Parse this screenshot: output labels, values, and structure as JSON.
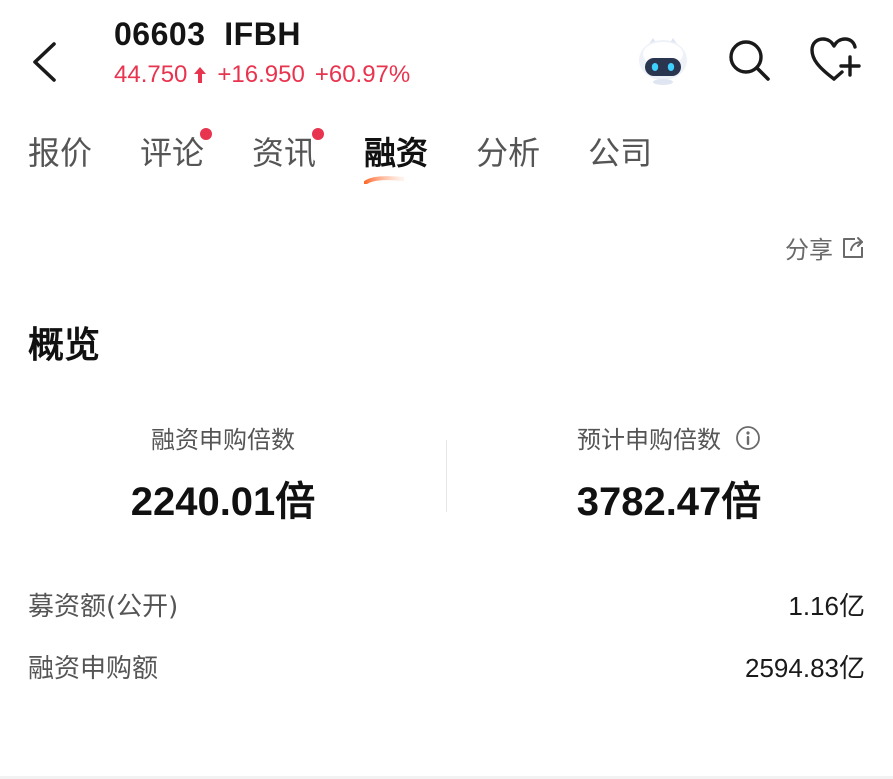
{
  "header": {
    "code": "06603",
    "name": "IFBH",
    "price": "44.750",
    "change": "+16.950",
    "change_pct": "+60.97%",
    "up_color": "#e8344e"
  },
  "header_icons": [
    "robot-assistant-icon",
    "search-icon",
    "heart-add-icon"
  ],
  "tabs": [
    {
      "label": "报价",
      "dot": false,
      "active": false
    },
    {
      "label": "评论",
      "dot": true,
      "active": false
    },
    {
      "label": "资讯",
      "dot": true,
      "active": false
    },
    {
      "label": "融资",
      "dot": false,
      "active": true
    },
    {
      "label": "分析",
      "dot": false,
      "active": false
    },
    {
      "label": "公司",
      "dot": false,
      "active": false
    }
  ],
  "share_label": "分享",
  "overview": {
    "title": "概览",
    "stats": [
      {
        "label": "融资申购倍数",
        "value": "2240.01",
        "unit": "倍"
      },
      {
        "label": "预计申购倍数",
        "value": "3782.47",
        "unit": "倍"
      }
    ],
    "rows": [
      {
        "label": "募资额(公开)",
        "value": "1.16",
        "unit": "亿"
      },
      {
        "label": "融资申购额",
        "value": "2594.83",
        "unit": "亿"
      }
    ]
  }
}
